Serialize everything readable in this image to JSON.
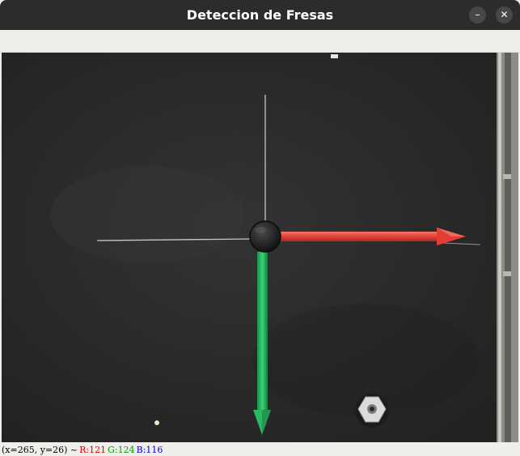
{
  "window": {
    "title": "Deteccion de Fresas",
    "minimize_glyph": "–",
    "close_glyph": "✕"
  },
  "status": {
    "coords": "(x=265, y=26) ~",
    "r": "R:121",
    "g": "G:124",
    "b": "B:116"
  },
  "colors": {
    "title_bar": "#2c2c2c",
    "board": "#2b2b2c",
    "x_axis_arrow": "#e8443a",
    "y_axis_arrow": "#2fc06a"
  },
  "icons": {
    "minimize": "minimize-icon",
    "close": "close-icon"
  }
}
